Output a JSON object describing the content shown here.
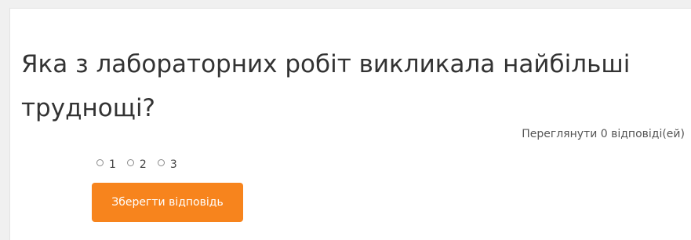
{
  "question": {
    "text": "Яка з лабораторних робіт викликала найбільші труднощі?"
  },
  "responses_link": {
    "label": "Переглянути 0 відповіді(ей)"
  },
  "options": [
    {
      "label": "1",
      "selected": false
    },
    {
      "label": "2",
      "selected": false
    },
    {
      "label": "3",
      "selected": false
    }
  ],
  "save_button": {
    "label": "Зберегти відповідь",
    "color": "#f7841d"
  }
}
